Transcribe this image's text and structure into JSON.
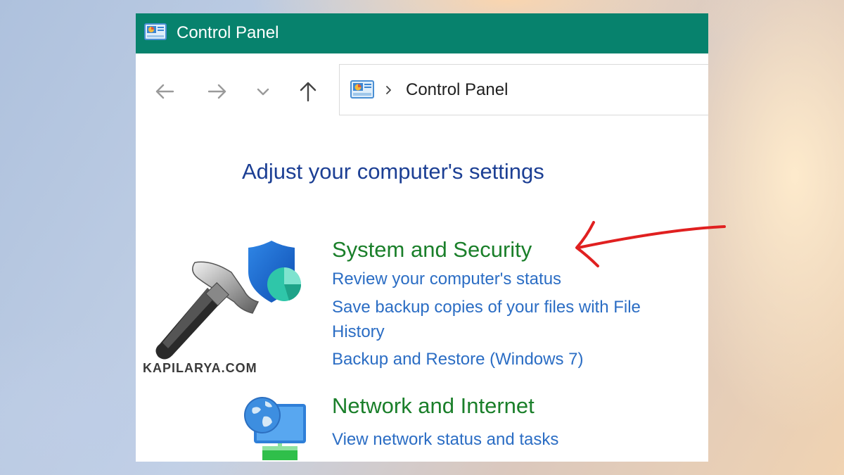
{
  "window": {
    "title": "Control Panel",
    "title_bar_color": "#07826d"
  },
  "navigation": {
    "back_icon": "arrow-left-icon",
    "forward_icon": "arrow-right-icon",
    "recent_icon": "chevron-down-icon",
    "up_icon": "arrow-up-icon"
  },
  "address_bar": {
    "location_icon": "control-panel-icon",
    "separator_icon": "chevron-right-icon",
    "location": "Control Panel"
  },
  "main": {
    "heading": "Adjust your computer's settings",
    "categories": [
      {
        "title": "System and Security",
        "icon": "shield-icon",
        "links": [
          "Review your computer's status",
          "Save backup copies of your files with File",
          "History",
          "Backup and Restore (Windows 7)"
        ]
      },
      {
        "title": "Network and Internet",
        "icon": "network-globe-icon",
        "links": [
          "View network status and tasks"
        ]
      }
    ]
  },
  "watermark": {
    "text": "KAPILARYA.COM",
    "icon": "hammer-icon"
  },
  "annotation": {
    "icon": "red-arrow-icon",
    "color": "#e02020"
  }
}
